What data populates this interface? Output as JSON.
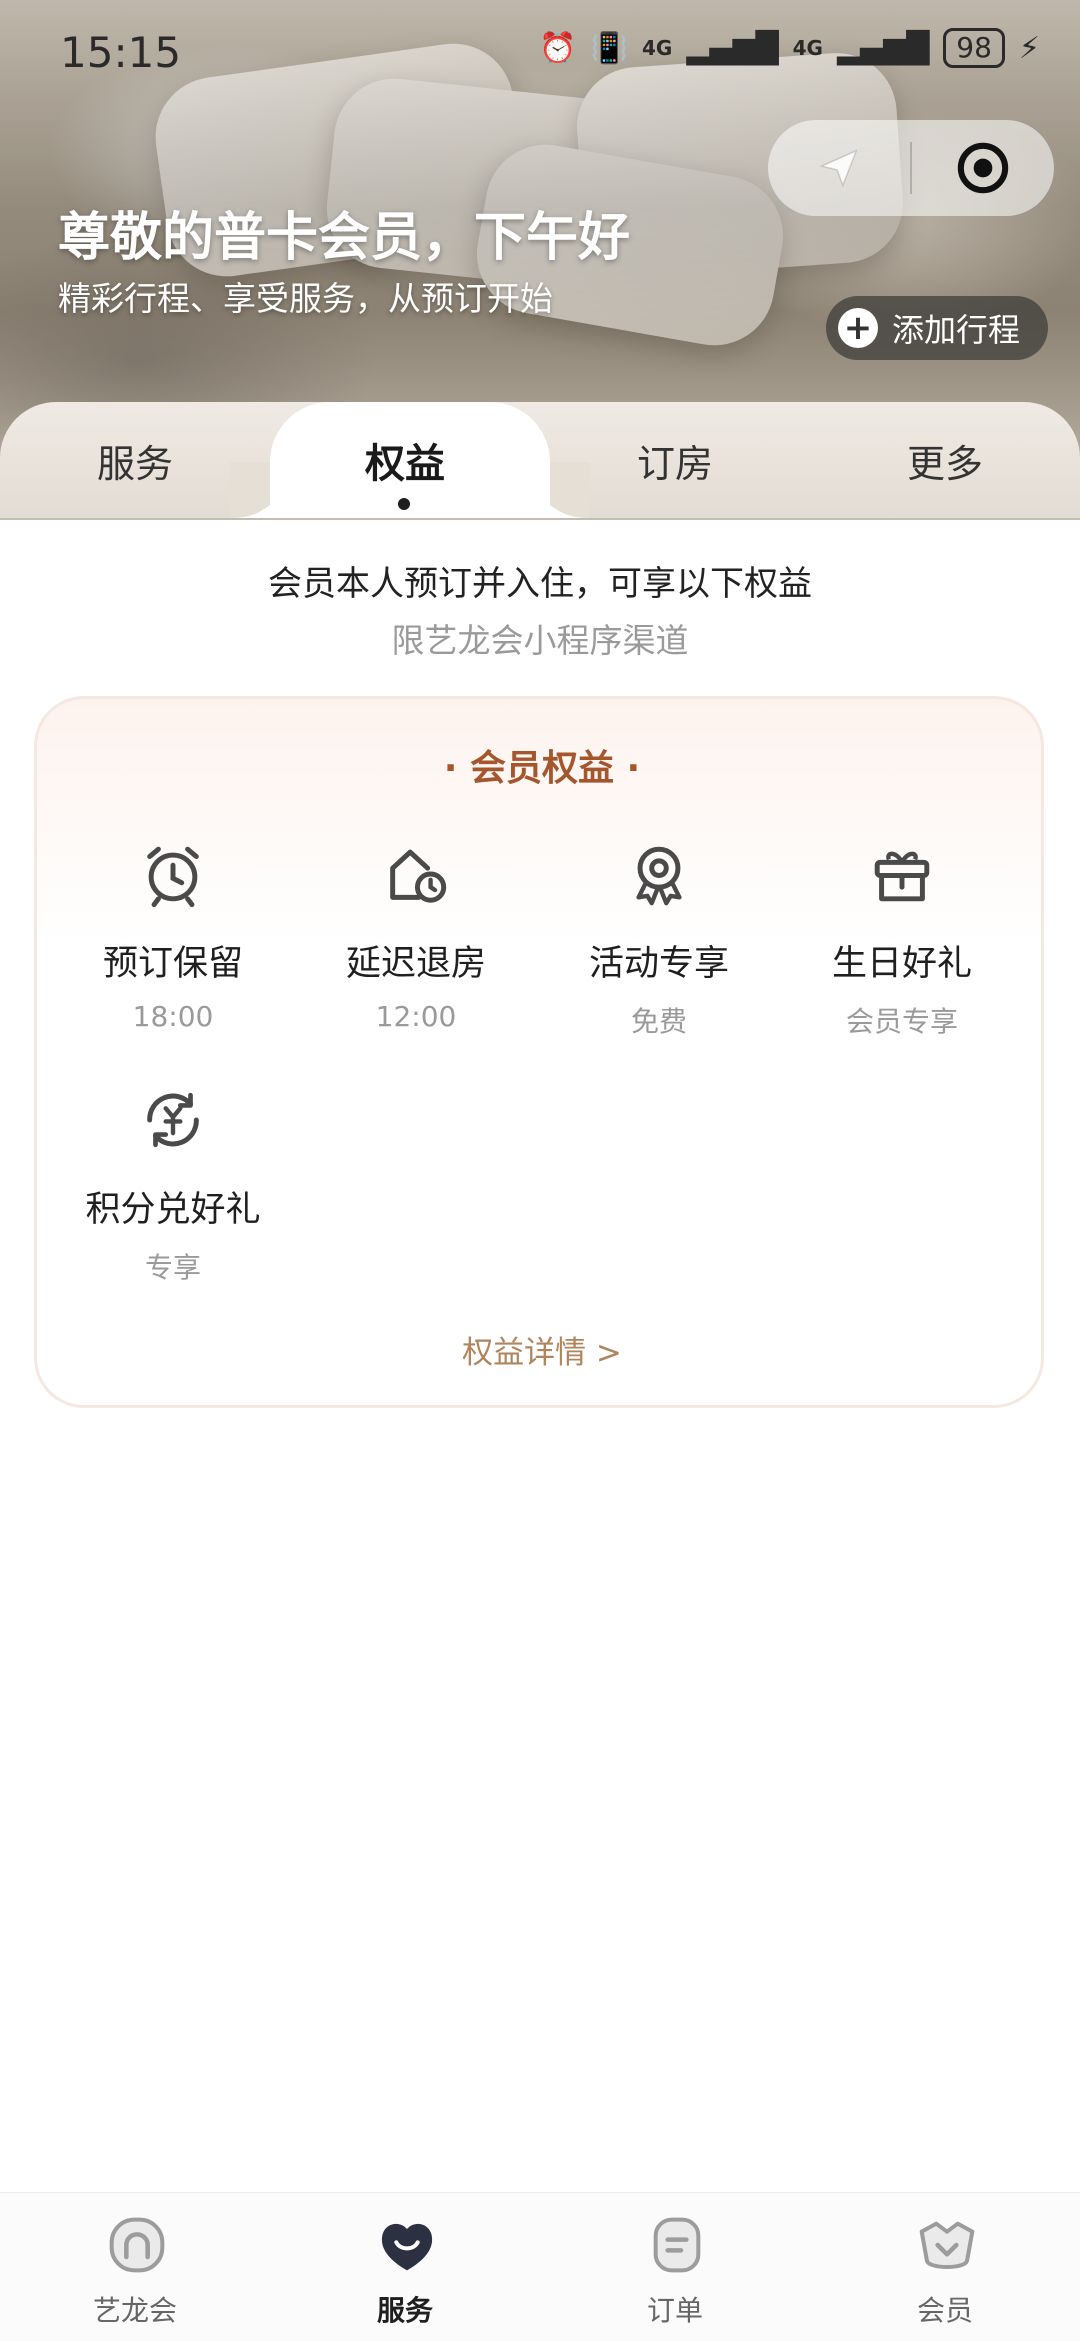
{
  "status_bar": {
    "time": "15:15",
    "battery": "98",
    "net1": "4G",
    "net2": "4G"
  },
  "hero": {
    "greeting": "尊敬的普卡会员，下午好",
    "subtitle": "精彩行程、享受服务，从预订开始",
    "add_trip_label": "添加行程"
  },
  "tabs": [
    {
      "label": "服务"
    },
    {
      "label": "权益",
      "active": true
    },
    {
      "label": "订房"
    },
    {
      "label": "更多"
    }
  ],
  "notice": {
    "line1": "会员本人预订并入住，可享以下权益",
    "line2": "限艺龙会小程序渠道"
  },
  "card": {
    "title": "· 会员权益 ·",
    "benefits": [
      {
        "name": "预订保留",
        "sub": "18:00",
        "icon": "alarm-clock-icon"
      },
      {
        "name": "延迟退房",
        "sub": "12:00",
        "icon": "house-clock-icon"
      },
      {
        "name": "活动专享",
        "sub": "免费",
        "icon": "award-medal-icon"
      },
      {
        "name": "生日好礼",
        "sub": "会员专享",
        "icon": "gift-box-icon"
      },
      {
        "name": "积分兑好礼",
        "sub": "专享",
        "icon": "points-exchange-icon"
      }
    ],
    "details_link": "权益详情 >"
  },
  "bottom_nav": [
    {
      "label": "艺龙会",
      "icon": "home-icon"
    },
    {
      "label": "服务",
      "icon": "service-heart-icon",
      "active": true
    },
    {
      "label": "订单",
      "icon": "order-icon"
    },
    {
      "label": "会员",
      "icon": "member-basket-icon"
    }
  ],
  "colors": {
    "accent": "#a5562c",
    "link": "#b0855e",
    "muted": "#9a9a9a",
    "nav_active": "#2b3140"
  }
}
